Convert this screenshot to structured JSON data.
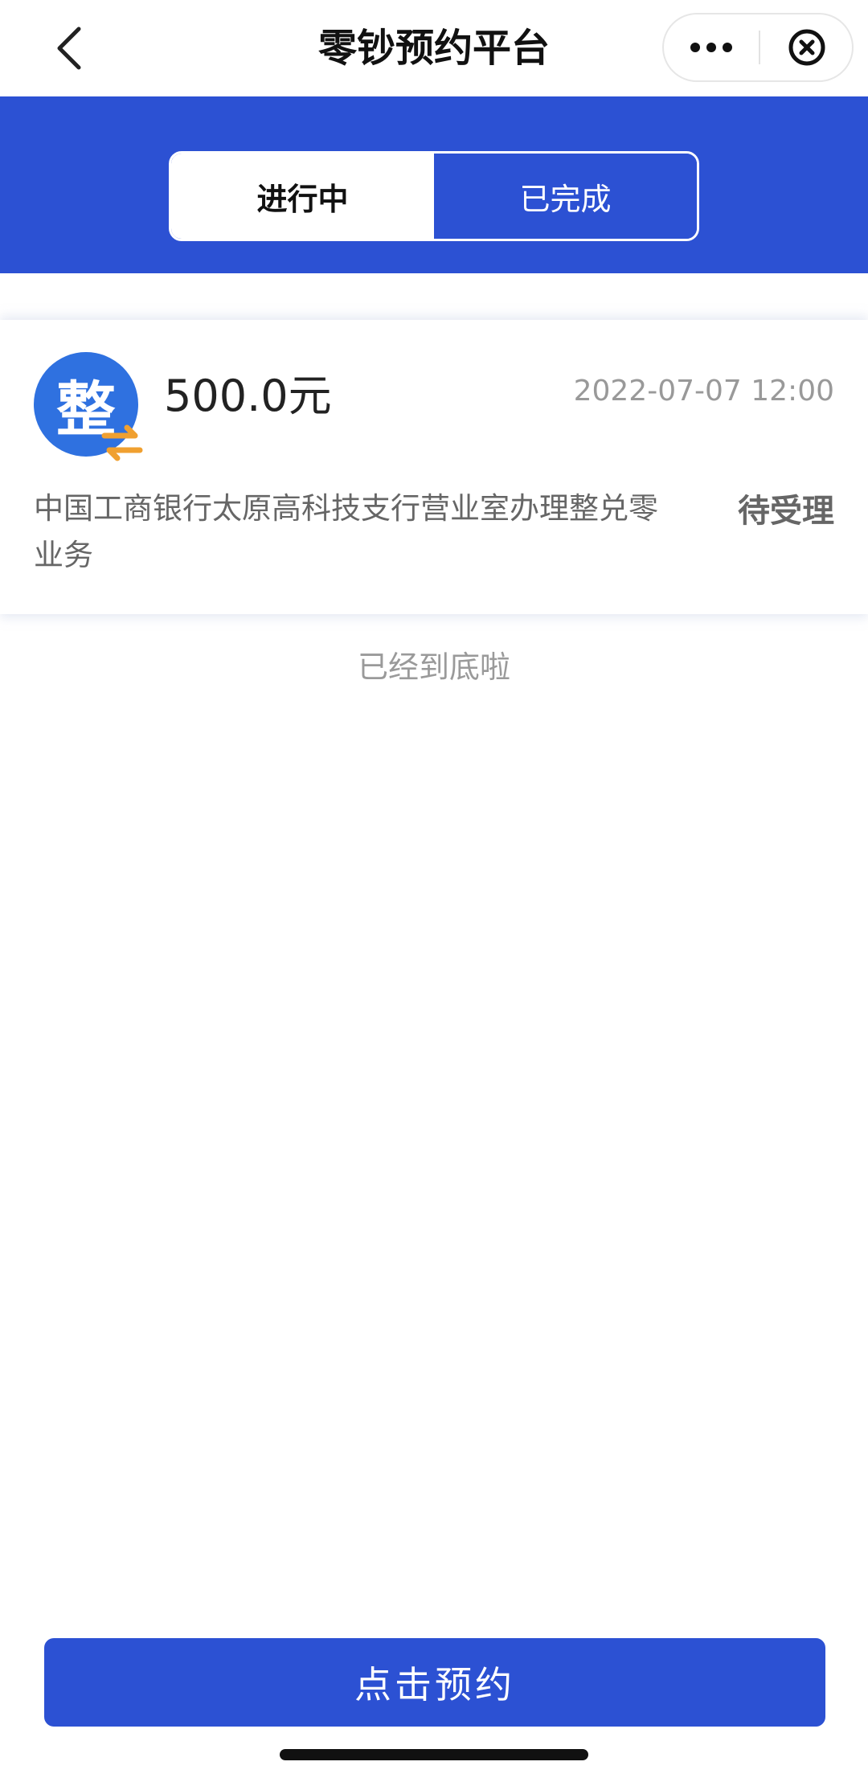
{
  "navbar": {
    "title": "零钞预约平台",
    "back_icon": "chevron-left-icon",
    "more_icon": "more-dots-icon",
    "close_icon": "close-circle-icon"
  },
  "tabs": [
    {
      "label": "进行中",
      "active": true
    },
    {
      "label": "已完成",
      "active": false
    }
  ],
  "colors": {
    "primary": "#2c51d3",
    "badge": "#2f71e0",
    "badge_accent": "#f0a030"
  },
  "appointments": [
    {
      "icon": "exchange-badge-icon",
      "icon_char": "整",
      "amount": "500.0元",
      "datetime": "2022-07-07 12:00",
      "description": "中国工商银行太原高科技支行营业室办理整兑零业务",
      "status": "待受理"
    }
  ],
  "list_end_text": "已经到底啦",
  "book_button_label": "点击预约"
}
